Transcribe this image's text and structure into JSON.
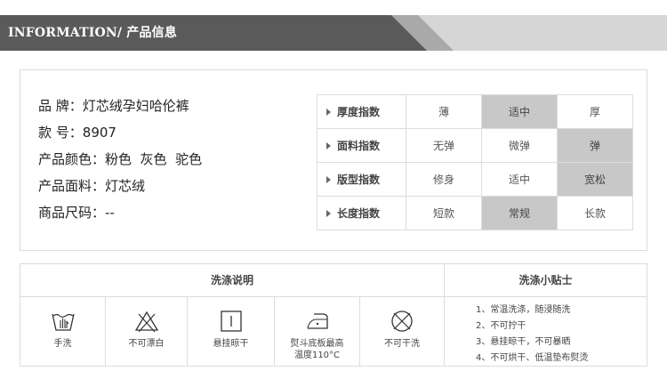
{
  "header": {
    "title_en": "INFORMATION/",
    "title_cn": " 产品信息",
    "colors": {
      "dark": "#5a5a5a",
      "mid": "#a9a9a9",
      "light": "#d6d6d6"
    }
  },
  "info": {
    "brand_label": "品 牌：",
    "brand_value": "灯芯绒孕妇哈伦裤",
    "model_label": "款 号：",
    "model_value": "8907",
    "color_label": "产品颜色：",
    "color_value": "粉色  灰色  驼色",
    "fabric_label": "产品面料：",
    "fabric_value": "灯芯绒",
    "size_label": "商品尺码：",
    "size_value": "--"
  },
  "index_table": {
    "rows": [
      {
        "name": "厚度指数",
        "options": [
          "薄",
          "适中",
          "厚"
        ],
        "selected": 1
      },
      {
        "name": "面料指数",
        "options": [
          "无弹",
          "微弹",
          "弹"
        ],
        "selected": 2
      },
      {
        "name": "版型指数",
        "options": [
          "修身",
          "适中",
          "宽松"
        ],
        "selected": 2
      },
      {
        "name": "长度指数",
        "options": [
          "短款",
          "常规",
          "长款"
        ],
        "selected": 1
      }
    ]
  },
  "wash": {
    "title_left": "洗涤说明",
    "title_right": "洗涤小贴士",
    "items": [
      {
        "icon": "hand-wash-icon",
        "caption": "手洗"
      },
      {
        "icon": "no-bleach-icon",
        "caption": "不可漂白"
      },
      {
        "icon": "hang-dry-icon",
        "caption": "悬挂晾干"
      },
      {
        "icon": "iron-icon",
        "caption": "熨斗底板最高",
        "caption2": "温度110°C"
      },
      {
        "icon": "no-dry-clean-icon",
        "caption": "不可干洗"
      }
    ],
    "tips": [
      "1、常温洗涤，随浸随洗",
      "2、不可拧干",
      "3、悬挂晾干，不可暴晒",
      "4、不可烘干、低温垫布熨烫"
    ]
  }
}
